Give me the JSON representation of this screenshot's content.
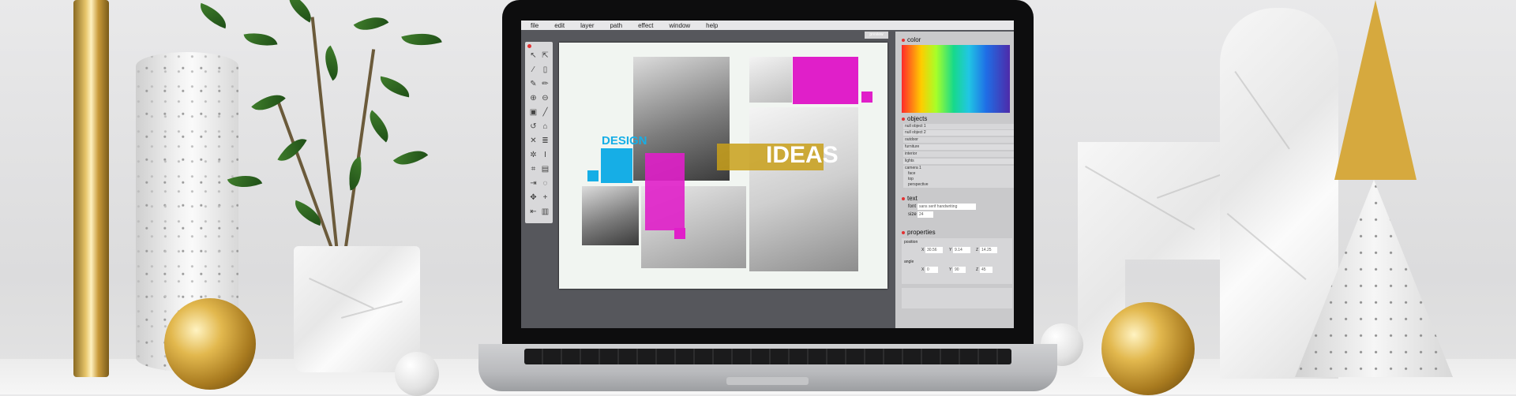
{
  "menu": [
    "file",
    "edit",
    "layer",
    "path",
    "effect",
    "window",
    "help"
  ],
  "pill_label": "preview",
  "canvas": {
    "design_text": "DESIGN",
    "ideas_text": "IDEAS"
  },
  "panel": {
    "color_header": "color",
    "objects_header": "objects",
    "objects": [
      "null object 1",
      "null object 2",
      "outdoor",
      "furniture",
      "interior",
      "lights",
      "camera 1",
      "face",
      "top",
      "perspective"
    ],
    "text_header": "text",
    "font_label": "font",
    "font_value": "sans serif handwriting",
    "size_label": "size",
    "size_value": "24",
    "properties_header": "properties",
    "position_label": "position",
    "position": {
      "x": "30.56",
      "y": "9.14",
      "z": "14.25"
    },
    "angle_label": "angle",
    "angle": {
      "x": "0",
      "y": "90",
      "z": "45"
    }
  },
  "colors": {
    "accent_magenta": "#e01fc9",
    "accent_cyan": "#16aee6",
    "accent_gold": "#c9a01a",
    "status_dot": "#e23232"
  },
  "tools": [
    "arrow-icon",
    "direct-select-icon",
    "brush-icon",
    "page-icon",
    "pen-icon",
    "pencil-icon",
    "zoom-in-icon",
    "zoom-out-icon",
    "lock-icon",
    "line-icon",
    "rotate-icon",
    "home-icon",
    "cut-icon",
    "stack-icon",
    "gear-icon",
    "text-icon",
    "crop-icon",
    "save-icon",
    "export-icon",
    "sync-icon",
    "move-icon",
    "add-icon",
    "exit-icon",
    "trash-icon"
  ]
}
